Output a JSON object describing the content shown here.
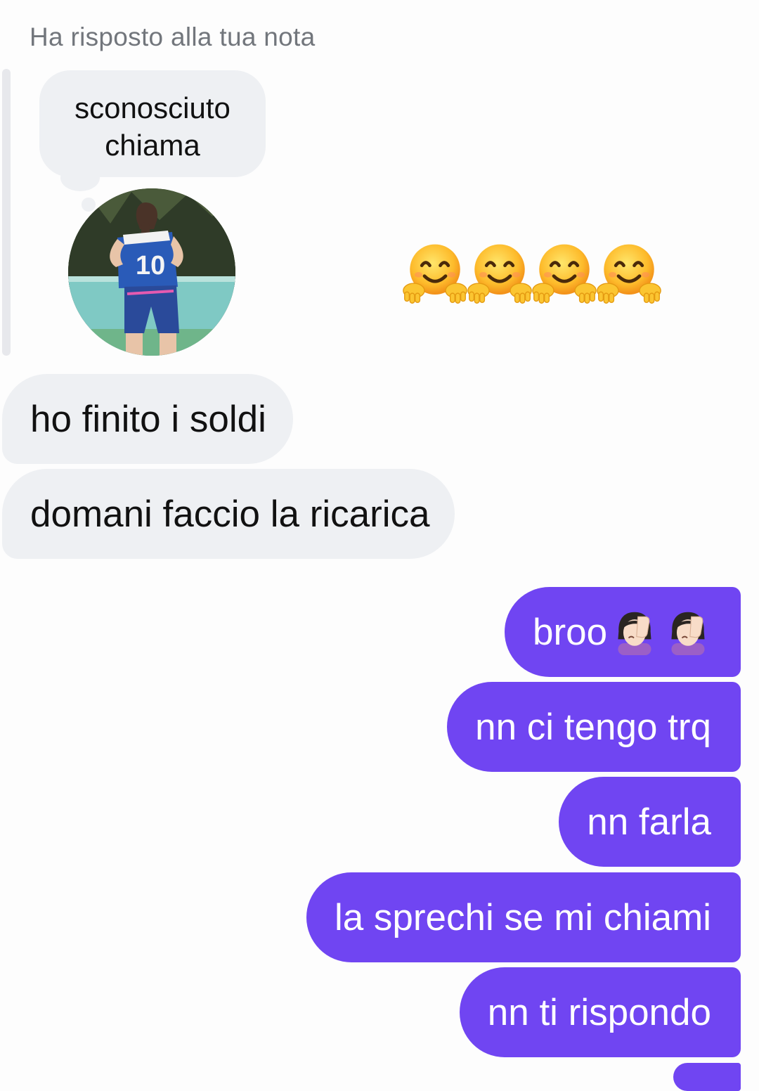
{
  "reply_header": "Ha risposto alla tua nota",
  "note": {
    "lines": [
      "sconosciuto",
      "chiama"
    ]
  },
  "reaction_emoji": "hugging-face",
  "messages": {
    "received": [
      "ho finito i soldi",
      "domani faccio la ricarica"
    ],
    "sent": [
      {
        "text": "broo",
        "emoji": [
          "woman-facepalming",
          "woman-facepalming"
        ]
      },
      {
        "text": "nn ci tengo trq"
      },
      {
        "text": "nn farla"
      },
      {
        "text": "la sprechi se mi chiami"
      },
      {
        "text": "nn ti rispondo"
      }
    ]
  },
  "colors": {
    "sent_bubble": "#7045f2",
    "received_bubble": "#eef0f3",
    "header_text": "#72767c"
  }
}
